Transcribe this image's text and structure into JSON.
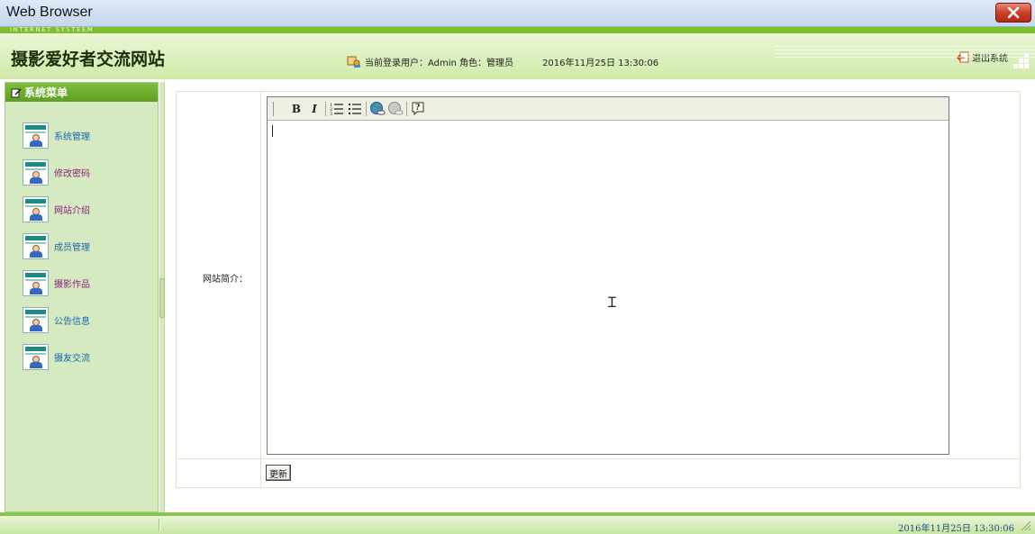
{
  "window": {
    "title": "Web Browser"
  },
  "header": {
    "subtitle": "INTERNET SYSTEEM",
    "site_title": "摄影爱好者交流网站",
    "user_info": "当前登录用户：Admin 角色：管理员",
    "datetime": "2016年11月25日  13:30:06",
    "logout_label": "退出系统"
  },
  "sidebar": {
    "menu_title": "系统菜单",
    "items": [
      {
        "label": "系统管理",
        "visited": false
      },
      {
        "label": "修改密码",
        "visited": true
      },
      {
        "label": "网站介绍",
        "visited": true
      },
      {
        "label": "成员管理",
        "visited": false
      },
      {
        "label": "摄影作品",
        "visited": true
      },
      {
        "label": "公告信息",
        "visited": false
      },
      {
        "label": "摄友交流",
        "visited": false
      }
    ]
  },
  "form": {
    "field_label": "网站简介：",
    "editor_value": "",
    "toolbar": [
      {
        "name": "bold-icon",
        "glyph": "B"
      },
      {
        "name": "italic-icon",
        "glyph": "I"
      },
      {
        "name": "ordered-list-icon"
      },
      {
        "name": "unordered-list-icon"
      },
      {
        "name": "link-icon"
      },
      {
        "name": "unlink-icon"
      },
      {
        "name": "help-icon",
        "glyph": "?"
      }
    ],
    "submit_label": "更新"
  },
  "statusbar": {
    "datetime": "2016年11月25日  13:30:06"
  },
  "colors": {
    "accent": "#7cbf2e",
    "sidebar_bg": "#d6eac1",
    "link": "#1866b0",
    "visited": "#8a1d7a"
  }
}
